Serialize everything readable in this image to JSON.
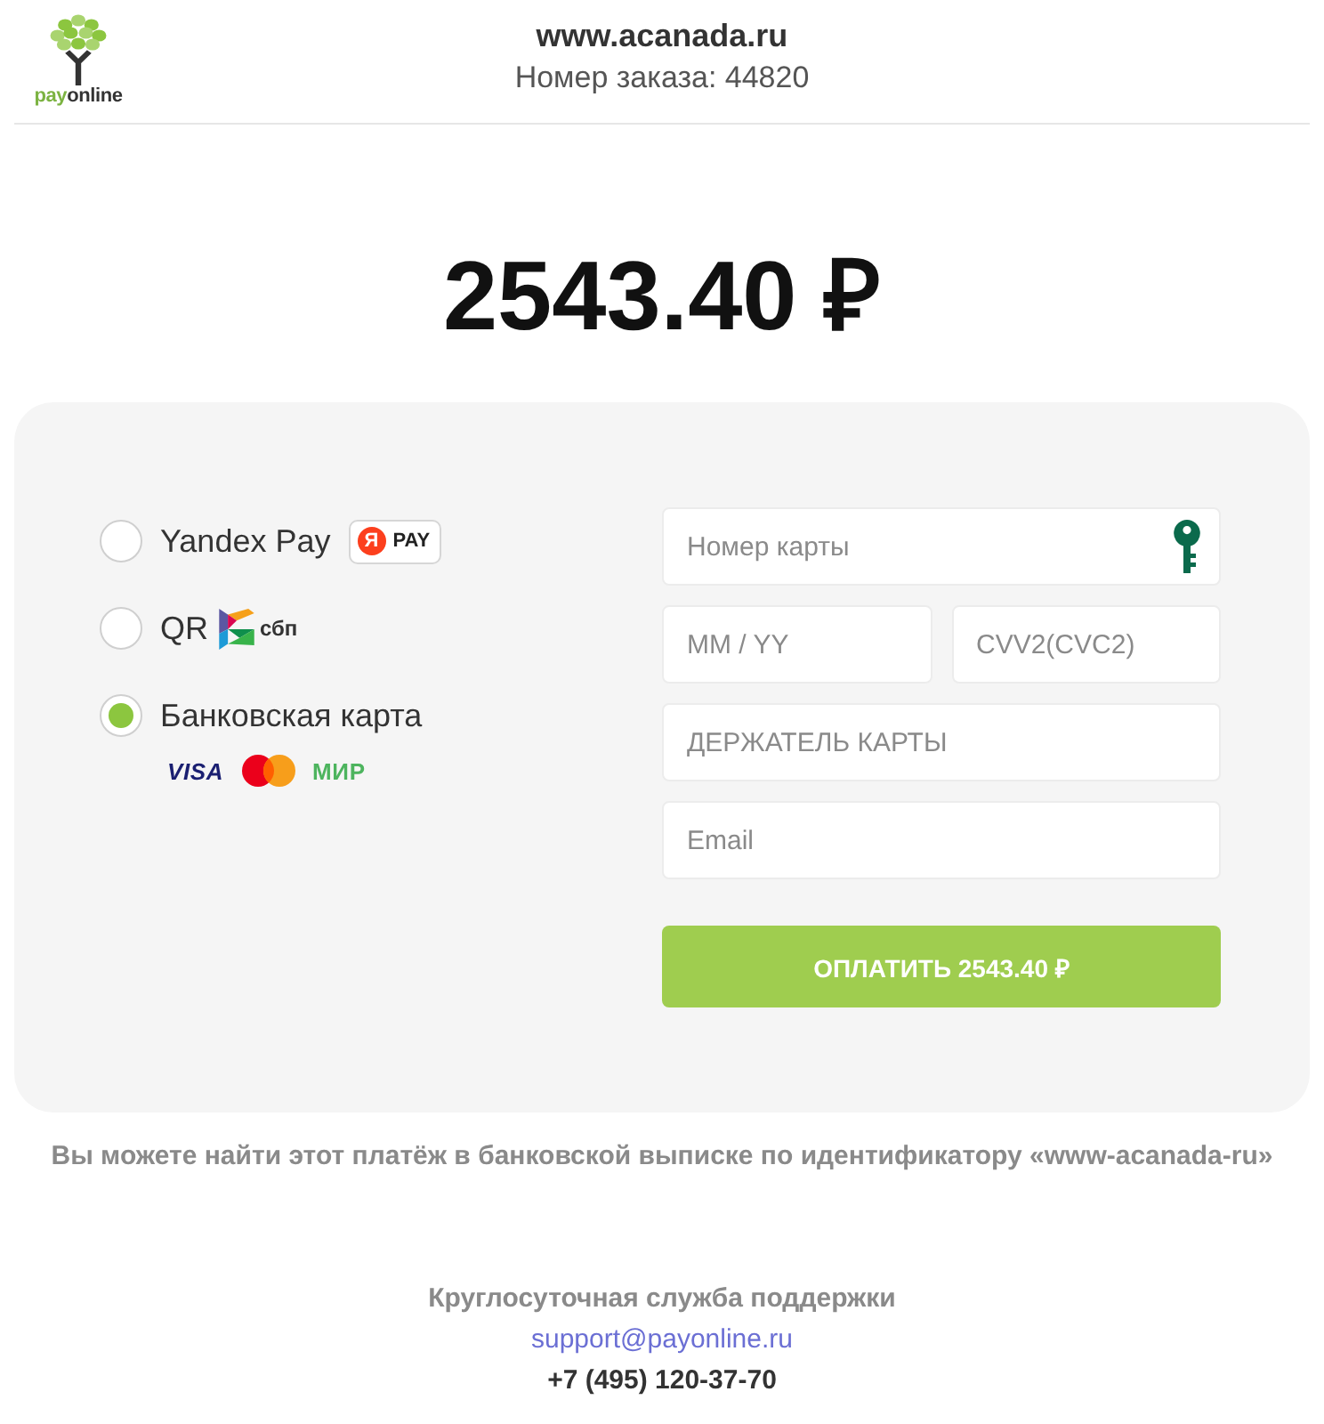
{
  "header": {
    "logo": {
      "wordmark": [
        "pay",
        "online"
      ]
    },
    "site": "www.acanada.ru",
    "order": "Номер заказа: 44820"
  },
  "amount": "2543.40 ₽",
  "payment": {
    "methods": [
      {
        "kind": "yandex",
        "label": "Yandex Pay",
        "selected": false,
        "badge": {
          "letter": "Я",
          "text": "PAY"
        }
      },
      {
        "kind": "sbp",
        "label": "QR",
        "selected": false,
        "logo_text": "сбп"
      },
      {
        "kind": "card",
        "label": "Банковская карта",
        "selected": true,
        "brands": [
          {
            "kind": "visa",
            "text": "VISA"
          },
          {
            "kind": "mastercard"
          },
          {
            "kind": "mir",
            "text": "МИР"
          }
        ]
      }
    ],
    "fields": [
      {
        "kind": "card_number",
        "placeholder": "Номер карты"
      },
      {
        "kind": "expiry",
        "placeholder": "MM / YY"
      },
      {
        "kind": "cvv",
        "placeholder": "CVV2(CVC2)"
      },
      {
        "kind": "holder",
        "placeholder": "ДЕРЖАТЕЛЬ КАРТЫ"
      },
      {
        "kind": "email",
        "placeholder": "Email"
      }
    ],
    "pay_button": "ОПЛАТИТЬ 2543.40 ₽"
  },
  "notice": "Вы можете найти этот платёж в банковской выписке по идентификатору «www-acanada-ru»",
  "support": {
    "title": "Круглосуточная служба поддержки",
    "email": "support@payonline.ru",
    "phone": "+7 (495) 120-37-70"
  }
}
